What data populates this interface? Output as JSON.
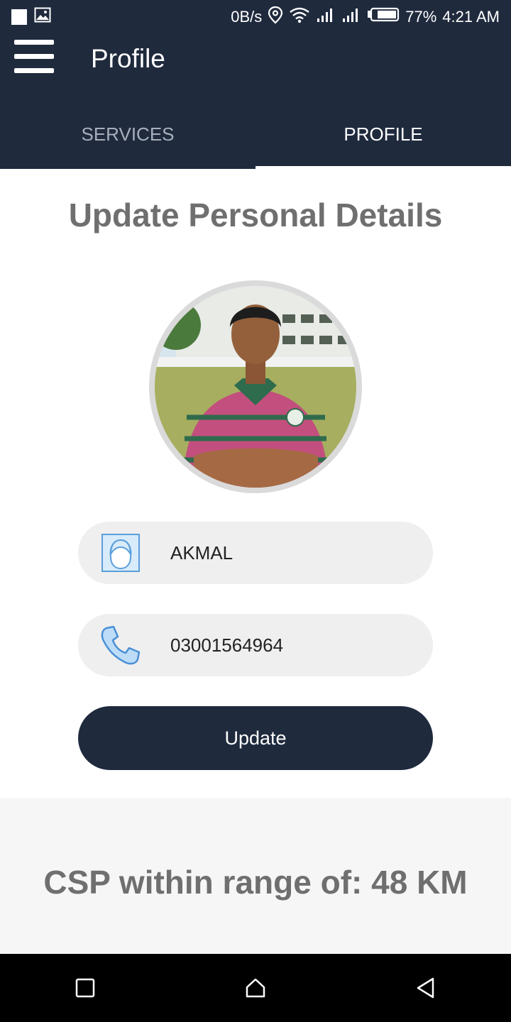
{
  "status_bar": {
    "net_speed": "0B/s",
    "battery": "77%",
    "time": "4:21 AM",
    "icons": [
      "notification-square-icon",
      "image-icon",
      "location-icon",
      "wifi-icon",
      "signal-icon",
      "signal-icon",
      "battery-icon"
    ]
  },
  "app_bar": {
    "title": "Profile",
    "menu_icon": "hamburger-menu-icon"
  },
  "tabs": [
    {
      "label": "SERVICES",
      "active": false
    },
    {
      "label": "PROFILE",
      "active": true
    }
  ],
  "main": {
    "heading": "Update Personal Details",
    "name_field": {
      "value": "AKMAL",
      "icon": "user-icon"
    },
    "phone_field": {
      "value": "03001564964",
      "icon": "phone-icon"
    },
    "update_button": "Update"
  },
  "range": {
    "text": "CSP within range of: 48 KM"
  },
  "nav_bar": {
    "icons": [
      "recent-apps-icon",
      "home-icon",
      "back-icon"
    ]
  },
  "colors": {
    "primary": "#1f2a3d",
    "field_bg": "#efefef",
    "heading_text": "#6f6f6f"
  }
}
